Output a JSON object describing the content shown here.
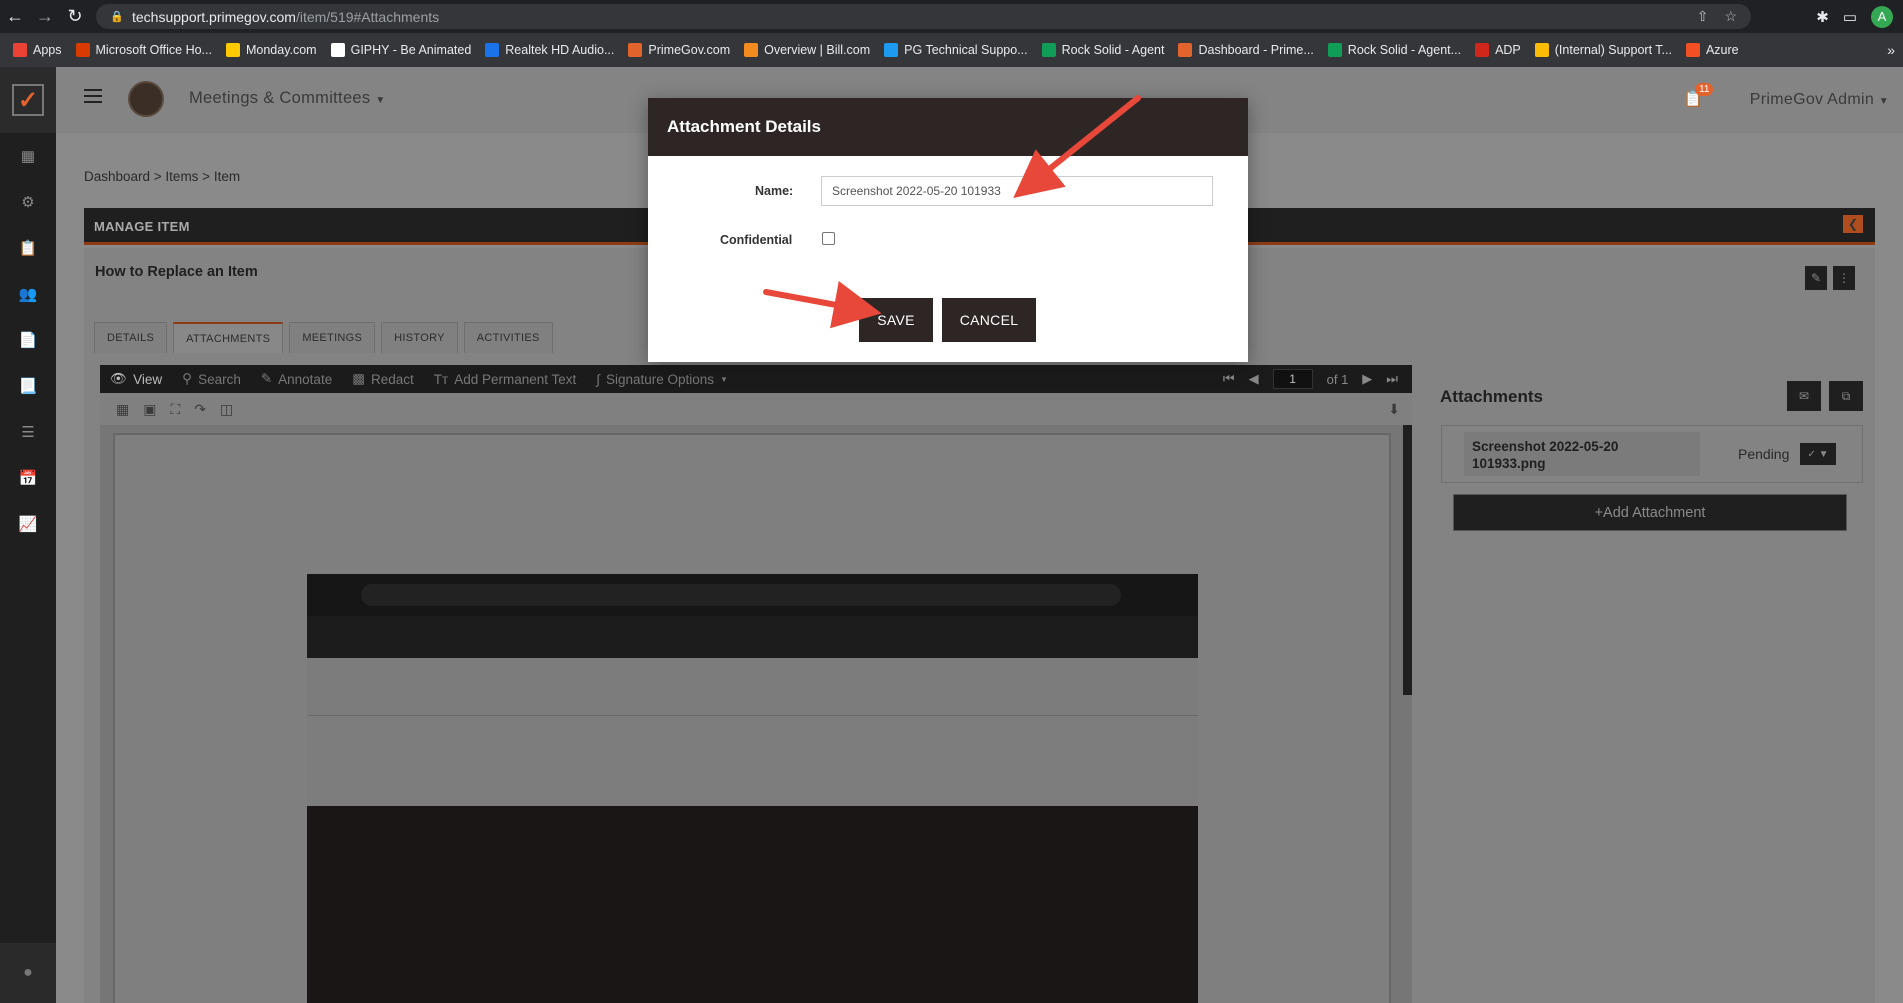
{
  "browser": {
    "url_host": "techsupport.primegov.com",
    "url_path": "/item/519#Attachments",
    "profile_initial": "A",
    "bookmarks": [
      {
        "label": "Apps",
        "color": "#ea4335"
      },
      {
        "label": "Microsoft Office Ho...",
        "color": "#d83b01"
      },
      {
        "label": "Monday.com",
        "color": "#ffcb00"
      },
      {
        "label": "GIPHY - Be Animated",
        "color": "#ffffff"
      },
      {
        "label": "Realtek HD Audio...",
        "color": "#1a73e8"
      },
      {
        "label": "PrimeGov.com",
        "color": "#e2632c"
      },
      {
        "label": "Overview | Bill.com",
        "color": "#f28b20"
      },
      {
        "label": "PG Technical Suppo...",
        "color": "#1d9bf0"
      },
      {
        "label": "Rock Solid - Agent",
        "color": "#0f9d58"
      },
      {
        "label": "Dashboard - Prime...",
        "color": "#e2632c"
      },
      {
        "label": "Rock Solid - Agent...",
        "color": "#0f9d58"
      },
      {
        "label": "ADP",
        "color": "#d0271d"
      },
      {
        "label": "(Internal) Support T...",
        "color": "#fbbc04"
      },
      {
        "label": "Azure",
        "color": "#f25022"
      }
    ]
  },
  "app": {
    "name": "Meetings & Committees",
    "admin": "PrimeGov Admin",
    "notification_count": "11"
  },
  "breadcrumb": "Dashboard > Items > Item",
  "manage": {
    "header": "MANAGE ITEM",
    "item_title": "How to Replace an Item",
    "tabs": [
      "DETAILS",
      "ATTACHMENTS",
      "MEETINGS",
      "HISTORY",
      "ACTIVITIES"
    ],
    "active_tab": "ATTACHMENTS"
  },
  "viewer": {
    "tools": [
      "View",
      "Search",
      "Annotate",
      "Redact",
      "Add Permanent Text",
      "Signature Options"
    ],
    "page_current": "1",
    "page_total": "of 1"
  },
  "attachments": {
    "title": "Attachments",
    "file_name": "Screenshot 2022-05-20 101933.png",
    "status": "Pending",
    "add_label": "+Add Attachment"
  },
  "modal": {
    "title": "Attachment Details",
    "name_label": "Name:",
    "name_value": "Screenshot 2022-05-20 101933",
    "confidential_label": "Confidential",
    "confidential_checked": false,
    "save_label": "SAVE",
    "cancel_label": "CANCEL"
  },
  "colors": {
    "accent": "#e2632c",
    "modal_header": "#2d2624",
    "annotation_arrow": "#e8483a"
  }
}
